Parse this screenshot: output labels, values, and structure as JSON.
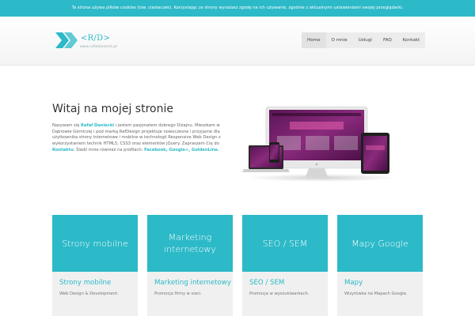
{
  "cookie_bar": {
    "text": "Ta strona używa plików cookies (tzw. ciasteczek). Korzystając ze strony wyrażasz zgodę na ich używanie, zgodnie z aktualnymi ustawieniami swojej przeglądarki."
  },
  "header": {
    "logo_text": "<R/D>",
    "logo_sub": "www.rafaldaniecki.pl",
    "nav": [
      {
        "label": "Home"
      },
      {
        "label": "O mnie"
      },
      {
        "label": "Usługi"
      },
      {
        "label": "FAQ"
      },
      {
        "label": "Kontakt"
      }
    ]
  },
  "intro": {
    "title": "Witaj na mojej stronie",
    "p1_a": "Nazywam się ",
    "p1_name": "Rafał Daniecki",
    "p1_b": " i jestem pasjonatem dobrego Dizajnu. Mieszkam w Dąbrowie Górniczej i pod marką RafDesign projektuje nowoczesne i przyjazne dla użytkownika strony internetowe i mobilne w technologii Responsive Web Design z wykorzystaniem technik HTML5, CSS3 oraz elementów jQuery. Zapraszam Cię do ",
    "p1_contact": "Kontaktu",
    "p1_c": ". Śledź mnie również na profilach: ",
    "p1_profiles": "Facebook, Google+, GoldenLine."
  },
  "cards": [
    {
      "banner": "Strony mobilne",
      "title": "Strony mobilne",
      "desc": "Web Design & Development."
    },
    {
      "banner": "Marketing internetowy",
      "title": "Marketing internetowy",
      "desc": "Promocja firmy w sieci."
    },
    {
      "banner": "SEO / SEM",
      "title": "SEO / SEM",
      "desc": "Promocja w wyszukiwarkach."
    },
    {
      "banner": "Mapy Google",
      "title": "Mapy",
      "desc": "Wizytówka na Mapach Google."
    }
  ],
  "colors": {
    "accent": "#2cb9c8",
    "card_bg": "#f0f0f0",
    "screen": "#7a1f6e"
  },
  "icons": {
    "logo": "double-chevron-icon",
    "devices": "responsive-devices-illustration"
  }
}
